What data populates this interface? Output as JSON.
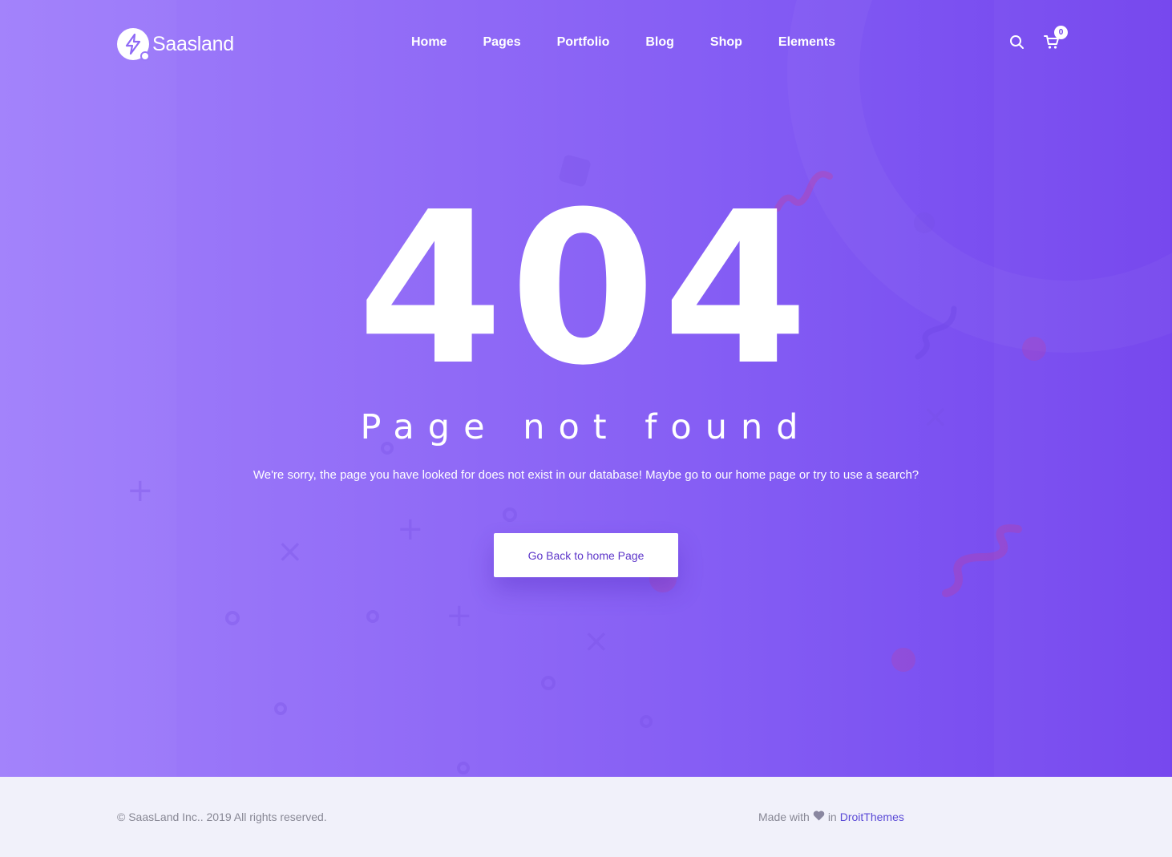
{
  "brand": {
    "name": "Saasland"
  },
  "nav": {
    "items": [
      {
        "label": "Home"
      },
      {
        "label": "Pages"
      },
      {
        "label": "Portfolio"
      },
      {
        "label": "Blog"
      },
      {
        "label": "Shop"
      },
      {
        "label": "Elements"
      }
    ],
    "search_icon": "search-icon",
    "cart_icon": "cart-icon",
    "cart_count": "0"
  },
  "error": {
    "code": "404",
    "title": "Page not found",
    "message": "We're sorry, the page you have looked for does not exist in our database! Maybe go to our home page or try to use a search?",
    "button_label": "Go Back to home Page"
  },
  "footer": {
    "copyright": "© SaasLand Inc.. 2019 All rights reserved.",
    "made_with": "Made with",
    "in": "in",
    "credit": "DroitThemes",
    "heart_icon": "heart-icon"
  },
  "colors": {
    "gradient_start": "#a180fb",
    "gradient_end": "#7444ee",
    "button_text": "#5c35c9",
    "footer_bg": "#f1f1fa",
    "link": "#5a49d6"
  }
}
